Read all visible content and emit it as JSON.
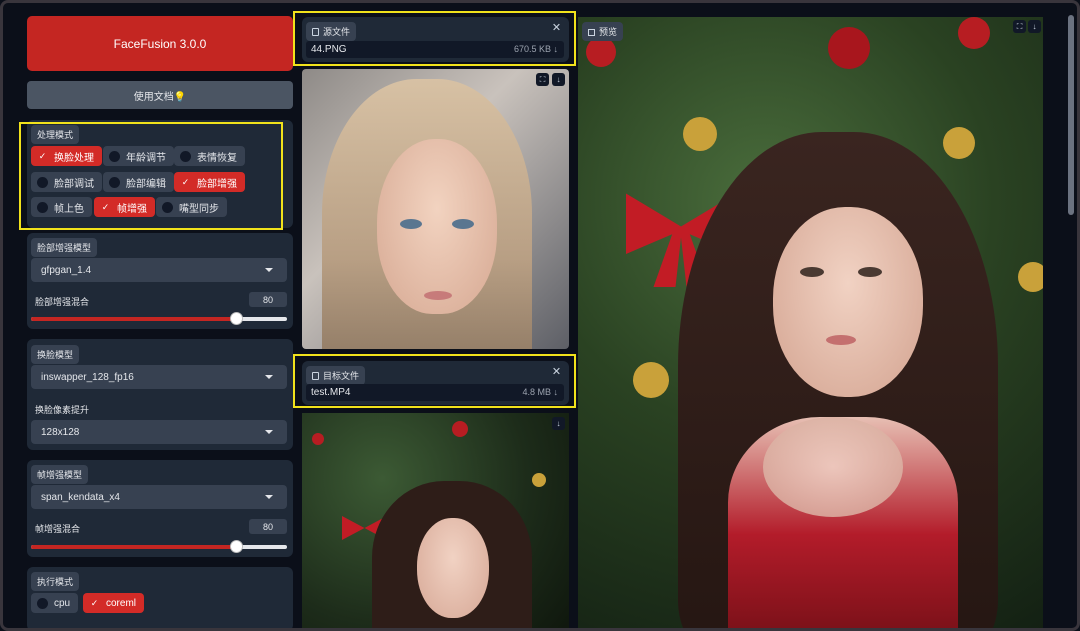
{
  "app": {
    "title": "FaceFusion 3.0.0",
    "docs_label": "使用文档💡"
  },
  "processors": {
    "label": "处理模式",
    "items": [
      {
        "label": "换脸处理",
        "checked": true
      },
      {
        "label": "年龄调节",
        "checked": false
      },
      {
        "label": "表情恢复",
        "checked": false
      },
      {
        "label": "脸部调试",
        "checked": false
      },
      {
        "label": "脸部编辑",
        "checked": false
      },
      {
        "label": "脸部增强",
        "checked": true
      },
      {
        "label": "帧上色",
        "checked": false
      },
      {
        "label": "帧增强",
        "checked": true
      },
      {
        "label": "嘴型同步",
        "checked": false
      }
    ]
  },
  "face_enhancer": {
    "model_label": "脸部增强模型",
    "model_value": "gfpgan_1.4",
    "blend_label": "脸部增强混合",
    "blend_value": "80",
    "blend_fraction": 0.8
  },
  "face_swapper": {
    "model_label": "换脸模型",
    "model_value": "inswapper_128_fp16",
    "pixel_boost_label": "换脸像素提升",
    "pixel_boost_value": "128x128"
  },
  "frame_enhancer": {
    "model_label": "帧增强模型",
    "model_value": "span_kendata_x4",
    "blend_label": "帧增强混合",
    "blend_value": "80",
    "blend_fraction": 0.8
  },
  "execution": {
    "label": "执行模式",
    "items": [
      {
        "label": "cpu",
        "checked": false
      },
      {
        "label": "coreml",
        "checked": true
      }
    ]
  },
  "source": {
    "label": "源文件",
    "file_name": "44.PNG",
    "file_size": "670.5 KB ↓"
  },
  "target": {
    "label": "目标文件",
    "file_name": "test.MP4",
    "file_size": "4.8 MB ↓"
  },
  "preview": {
    "label": "预览"
  },
  "icons": [
    "file-icon",
    "close-icon",
    "fullscreen-icon",
    "download-icon",
    "image-icon",
    "checkbox-icon",
    "caret-down-icon"
  ],
  "colors": {
    "accent": "#c42622",
    "background": "#0b0f19",
    "panel": "#1f2937",
    "highlight": "#f1e21b"
  }
}
